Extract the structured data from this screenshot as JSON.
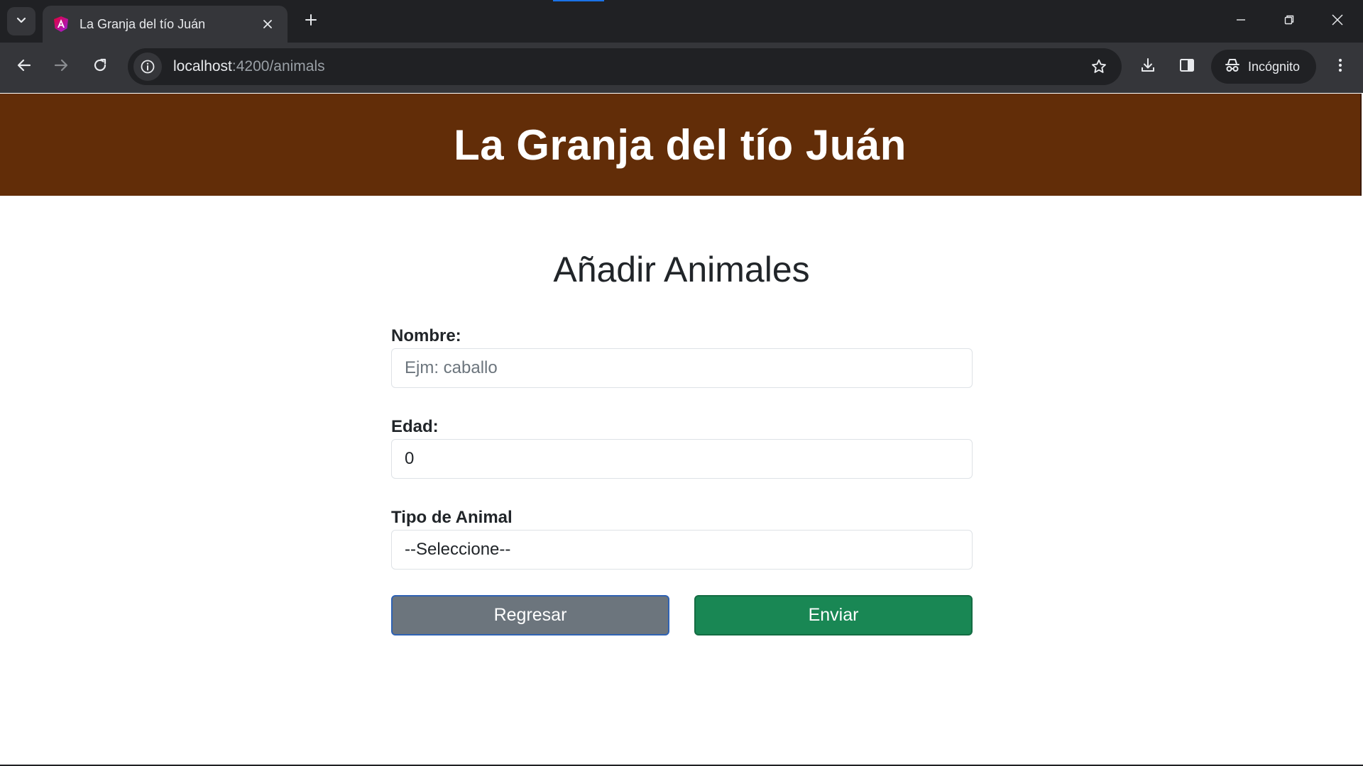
{
  "browser": {
    "tab_title": "La Granja del tío Juán",
    "url_host": "localhost",
    "url_path": ":4200/animals",
    "profile_label": "Incógnito"
  },
  "page": {
    "header_title": "La Granja del tío Juán",
    "form_title": "Añadir Animales",
    "fields": {
      "nombre": {
        "label": "Nombre:",
        "placeholder": "Ejm: caballo",
        "value": ""
      },
      "edad": {
        "label": "Edad:",
        "placeholder": "",
        "value": "0"
      },
      "tipo": {
        "label": "Tipo de Animal",
        "selected": "--Seleccione--"
      }
    },
    "buttons": {
      "back": "Regresar",
      "send": "Enviar"
    }
  },
  "colors": {
    "header_bg": "#622d08",
    "back_button": "#6c757d",
    "send_button": "#198754"
  },
  "icons": [
    "tab-search-icon",
    "angular-favicon-icon",
    "close-icon",
    "plus-icon",
    "minimize-icon",
    "restore-icon",
    "window-close-icon",
    "back-arrow-icon",
    "forward-arrow-icon",
    "reload-icon",
    "site-info-icon",
    "star-icon",
    "download-icon",
    "side-panel-icon",
    "incognito-icon",
    "more-vert-icon"
  ]
}
